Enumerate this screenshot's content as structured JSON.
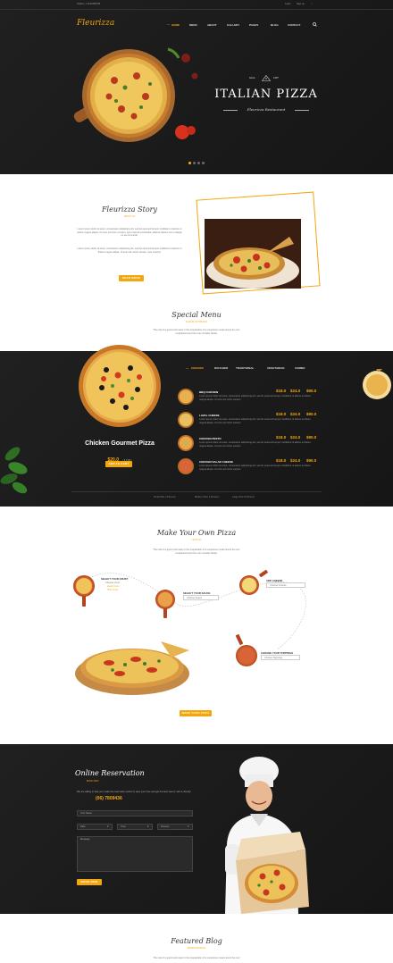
{
  "topbar": {
    "phone": "Hotline: 1-0123456789",
    "login": "Login",
    "signup": "Sign up"
  },
  "header": {
    "logo": "Fleurizza"
  },
  "nav": {
    "items": [
      "HOME",
      "MENU",
      "ABOUT",
      "GALLERY",
      "PAGES",
      "BLOG",
      "CONTACT"
    ],
    "active": 0
  },
  "hero": {
    "badge_left": "Since",
    "badge_right": "1987",
    "title": "ITALIAN PIZZA",
    "subtitle": "Fleurizza Restaurant",
    "dots": 4,
    "active_dot": 0
  },
  "story": {
    "title": "Fleurizza Story",
    "sub": "ABOUT US",
    "p1": "Lorem ipsum dolor sit amet, consectetur adipisicing elit, sed do eiusmod tempor incididunt ut labore et dolore magna aliqua. Ut enim ad minim veniam, quis nostrud exercitation ullamco laboris nisi ut aliquip ex ea commodo.",
    "p2": "Lorem ipsum dolor sit amet, consectetur adipisicing elit, sed do eiusmod tempor incididunt ut labore et dolore magna aliqua. Ut enim ad minim veniam, quis nostrud.",
    "button": "READ MORE"
  },
  "special": {
    "title": "Special Menu",
    "sub": "FLAVOR OF THE DAY",
    "desc1": "The role of a good cook ware in the preparation of a sumptuous meal cannot be over",
    "desc2": "emphasized and the one consider ideals.",
    "tabs": [
      "CHICKEN",
      "DOUCHER",
      "TRADITIONAL",
      "VEGETARIAN",
      "COMBO"
    ],
    "active_tab": 0,
    "featured": {
      "name": "Chicken Gourmet Pizza",
      "price": "$20.0",
      "size": "( 8 FT/B )",
      "button": "ADD TO CART"
    },
    "items": [
      {
        "name": "BBQ CHICKEN",
        "price1": "$18.0",
        "price2": "$24.0",
        "price3": "$90.0",
        "desc": "Lorem ipsum dolor sit amet, consectetur adipisicing elit, sed do eiusmod tempor incididunt ut labore et dolore magna aliqua. Ut enim ad minim veniam."
      },
      {
        "name": "LAVAL CHEESE",
        "price1": "$18.0",
        "price2": "$24.0",
        "price3": "$90.0",
        "desc": "Lorem ipsum dolor sit amet, consectetur adipisicing elit, sed do eiusmod tempor incididunt ut labore et dolore magna aliqua. Ut enim ad minim veniam."
      },
      {
        "name": "CHICKEN PESTO",
        "price1": "$18.0",
        "price2": "$24.0",
        "price3": "$90.0",
        "desc": "Lorem ipsum dolor sit amet, consectetur adipisicing elit, sed do eiusmod tempor incididunt ut labore et dolore magna aliqua. Ut enim ad minim veniam."
      },
      {
        "name": "CHICKEN SALAD CHEESE",
        "price1": "$18.0",
        "price2": "$24.0",
        "price3": "$90.0",
        "desc": "Lorem ipsum dolor sit amet, consectetur adipisicing elit, sed do eiusmod tempor incididunt ut labore et dolore magna aliqua. Ut enim ad minim veniam."
      }
    ],
    "sizes": [
      "Small Size 2 Persons",
      "Medium Size 4 Persons",
      "Large Size 8 Persons"
    ]
  },
  "make": {
    "title": "Make Your Own Pizza",
    "sub": "LET'S GO",
    "desc1": "The role of a good cook ware in the preparation of a sumptuous meal cannot be over",
    "desc2": "emphasized and the one consider ideals.",
    "crust": {
      "label": "SELECT YOUR CRUST",
      "opts": [
        "Choose Crust",
        "Hand Crust",
        "Thin Crust"
      ]
    },
    "sauce": {
      "label": "SELECT YOUR SAUCE",
      "select": "Choose Sauce"
    },
    "cheese": {
      "label": "ADD CHEESE",
      "select": "Choose Cheese"
    },
    "toppings": {
      "label": "CHOOSE YOUR TOPPINGS",
      "select": "Choose Toppings"
    },
    "button": "MAKE YOUR PIZZA"
  },
  "reservation": {
    "title": "Online Reservation",
    "sub": "BOOK NOW",
    "text": "We are willing to help you make the reservation online to save your time and get the best seat or call us directly:",
    "phone": "(06) 7809436",
    "name_ph": "Your Name",
    "date_ph": "Date",
    "time_ph": "Time",
    "persons_ph": "Persons",
    "message_ph": "Message",
    "button": "BOOK NOW"
  },
  "blog": {
    "title": "Featured Blog",
    "sub": "FROM OUR BLOG",
    "desc1": "The role of a good cook ware in the preparation of a sumptuous meal cannot be over"
  },
  "colors": {
    "accent": "#f4a60d",
    "dark": "#1c1c1c"
  }
}
